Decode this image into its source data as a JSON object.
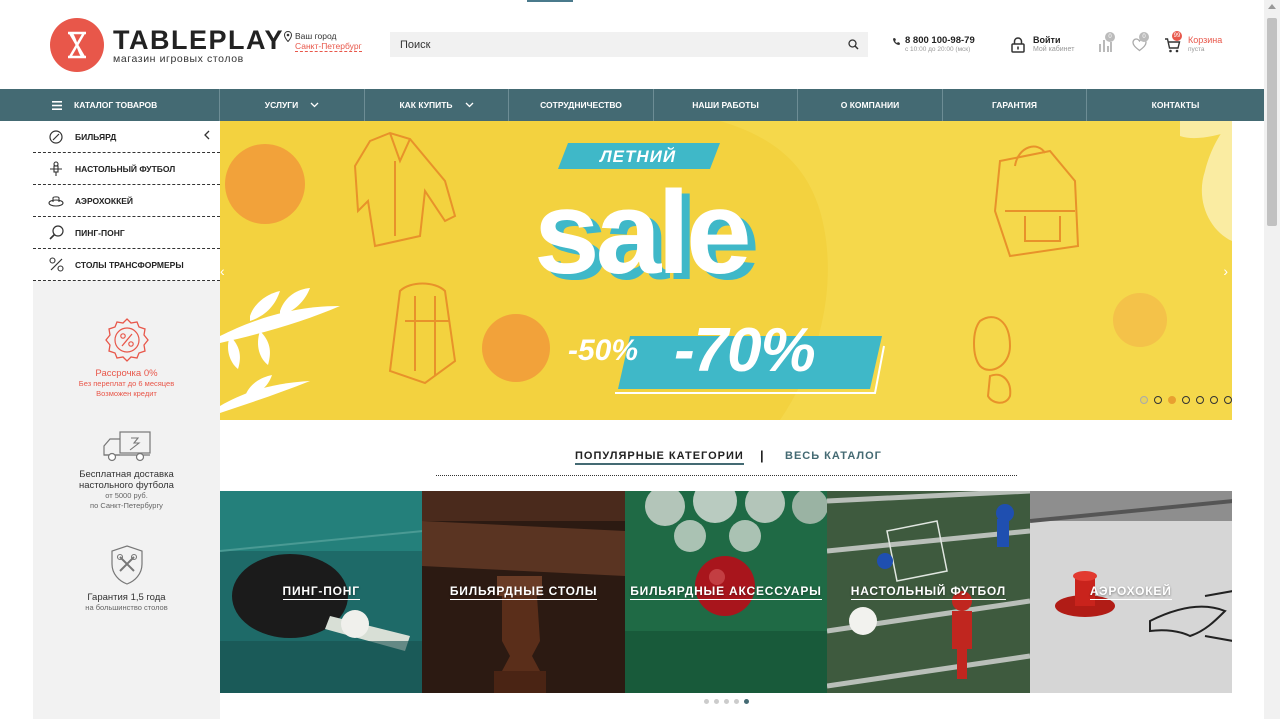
{
  "header": {
    "logo_title": "TABLEPLAY",
    "logo_subtitle": "магазин игровых столов",
    "city_label": "Ваш город",
    "city_value": "Санкт-Петербург",
    "search_placeholder": "Поиск",
    "phone": "8 800 100-98-79",
    "phone_hours": "с 10:00 до 20:00 (мск)",
    "login_title": "Войти",
    "login_sub": "Мой кабинет",
    "compare_count": "0",
    "favorites_count": "0",
    "cart_count": "99",
    "cart_title": "Корзина",
    "cart_sub": "пуста"
  },
  "nav": {
    "catalog_label": "КАТАЛОГ ТОВАРОВ",
    "items": [
      {
        "label": "УСЛУГИ",
        "dropdown": true
      },
      {
        "label": "КАК КУПИТЬ",
        "dropdown": true
      },
      {
        "label": "СОТРУДНИЧЕСТВО",
        "dropdown": false
      },
      {
        "label": "НАШИ РАБОТЫ",
        "dropdown": false
      },
      {
        "label": "О КОМПАНИИ",
        "dropdown": false
      },
      {
        "label": "ГАРАНТИЯ",
        "dropdown": false
      },
      {
        "label": "КОНТАКТЫ",
        "dropdown": false
      }
    ]
  },
  "sidebar": {
    "categories": [
      {
        "label": "БИЛЬЯРД",
        "icon": "billiard-icon"
      },
      {
        "label": "НАСТОЛЬНЫЙ ФУТБОЛ",
        "icon": "foosball-icon"
      },
      {
        "label": "АЭРОХОККЕЙ",
        "icon": "air-hockey-icon"
      },
      {
        "label": "ПИНГ-ПОНГ",
        "icon": "ping-pong-icon"
      },
      {
        "label": "СТОЛЫ ТРАНСФОРМЕРЫ",
        "icon": "transformer-icon"
      }
    ],
    "perks": [
      {
        "title": "Рассрочка 0%",
        "sub1": "Без переплат до 6 месяцев",
        "sub2": "Возможен кредит"
      },
      {
        "title": "Бесплатная доставка",
        "title2": "настольного футбола",
        "sub1": "от 5000 руб.",
        "sub2": "по Санкт-Петербургу"
      },
      {
        "title": "Гарантия 1,5 года",
        "sub1": "на большинство столов"
      }
    ]
  },
  "banner": {
    "tag": "ЛЕТНИЙ",
    "headline": "sale",
    "discount_small": "-50%",
    "discount_big": "-70%",
    "slides_count": 7,
    "active_slide": 2
  },
  "popular": {
    "tab_popular": "ПОПУЛЯРНЫЕ КАТЕГОРИИ",
    "separator": "|",
    "tab_all": "ВЕСЬ КАТАЛОГ",
    "tiles": [
      {
        "label": "ПИНГ-ПОНГ"
      },
      {
        "label": "БИЛЬЯРДНЫЕ СТОЛЫ"
      },
      {
        "label": "БИЛЬЯРДНЫЕ АКСЕССУАРЫ"
      },
      {
        "label": "НАСТОЛЬНЫЙ ФУТБОЛ"
      },
      {
        "label": "АЭРОХОКЕЙ"
      }
    ],
    "pages_count": 5,
    "active_page": 5
  },
  "colors": {
    "brand_red": "#e8574a",
    "nav_bg": "#446a73",
    "banner_yellow": "#f3d23f",
    "banner_teal": "#3fb8c8",
    "banner_orange": "#f2a23a"
  }
}
